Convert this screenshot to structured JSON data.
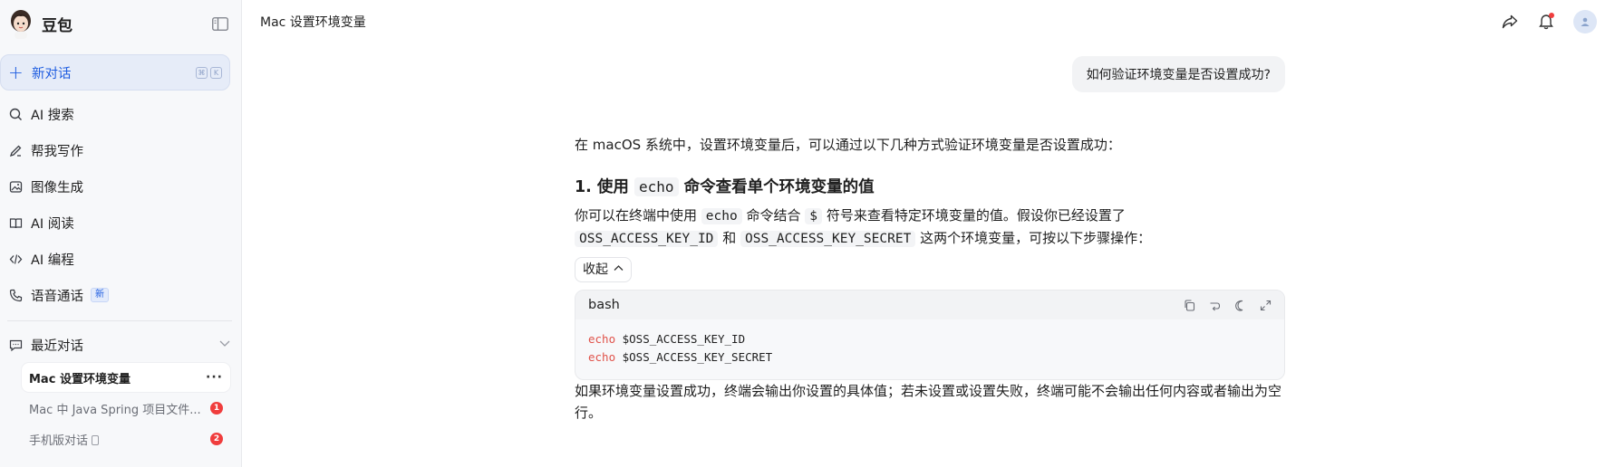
{
  "sidebar": {
    "brand": "豆包",
    "new_chat": {
      "label": "新对话",
      "shortcut": [
        "⌘",
        "K"
      ]
    },
    "nav": [
      {
        "label": "AI 搜索",
        "icon": "search-icon"
      },
      {
        "label": "帮我写作",
        "icon": "pen-icon"
      },
      {
        "label": "图像生成",
        "icon": "image-icon"
      },
      {
        "label": "AI 阅读",
        "icon": "book-icon"
      },
      {
        "label": "AI 编程",
        "icon": "code-icon"
      },
      {
        "label": "语音通话",
        "icon": "phone-icon",
        "badge": "新"
      }
    ],
    "recent": {
      "label": "最近对话",
      "items": [
        {
          "title": "Mac 设置环境变量",
          "active": true
        },
        {
          "title": "Mac 中 Java Spring 项目文件...",
          "count": "1"
        },
        {
          "title": "手机版对话",
          "count": "2"
        }
      ]
    }
  },
  "header": {
    "title": "Mac 设置环境变量"
  },
  "chat": {
    "user_message": "如何验证环境变量是否设置成功?",
    "intro": "在 macOS 系统中，设置环境变量后，可以通过以下几种方式验证环境变量是否设置成功：",
    "section1": {
      "prefix": "1. 使用",
      "code": "echo",
      "suffix": "命令查看单个环境变量的值"
    },
    "para1": {
      "t1": "你可以在终端中使用",
      "c1": "echo",
      "t2": "命令结合",
      "c2": "$",
      "t3": "符号来查看特定环境变量的值。假设你已经设置了",
      "c3": "OSS_ACCESS_KEY_ID",
      "t4": "和",
      "c4": "OSS_ACCESS_KEY_SECRET",
      "t5": "这两个环境变量，可按以下步骤操作："
    },
    "collapse_label": "收起",
    "code_block": {
      "lang": "bash",
      "lines": [
        {
          "kw": "echo",
          "rest": " $OSS_ACCESS_KEY_ID"
        },
        {
          "kw": "echo",
          "rest": " $OSS_ACCESS_KEY_SECRET"
        }
      ]
    },
    "after": "如果环境变量设置成功，终端会输出你设置的具体值；若未设置或设置失败，终端可能不会输出任何内容或者输出为空行。"
  },
  "colors": {
    "accent": "#1d5ce0",
    "badge_red": "#f03d3d",
    "keyword": "#e0524a"
  }
}
